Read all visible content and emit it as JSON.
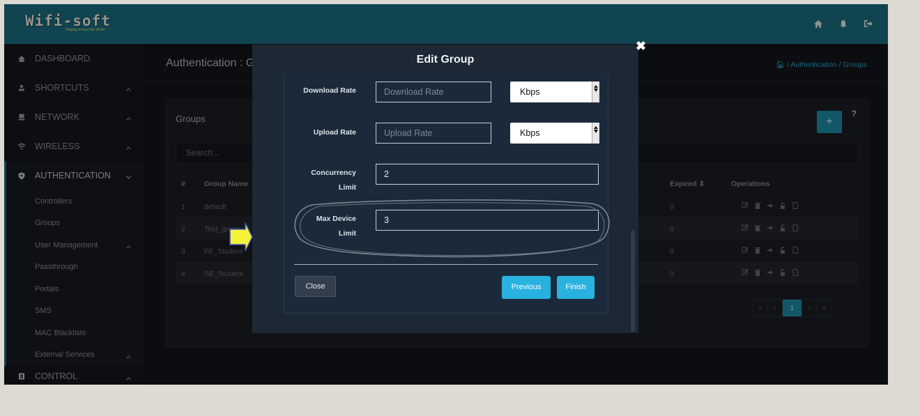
{
  "app": {
    "logo_text": "Wifi-soft",
    "logo_tagline": "Helping ensure the World"
  },
  "sidebar": {
    "sections_top": [
      {
        "label": "DASHBOARD",
        "icon": "dashboard-icon"
      },
      {
        "label": "SHORTCUTS",
        "icon": "user-icon",
        "chevron": "^"
      },
      {
        "label": "NETWORK",
        "icon": "monitor-icon",
        "chevron": "^"
      },
      {
        "label": "WIRELESS",
        "icon": "wifi-icon",
        "chevron": "^"
      },
      {
        "label": "AUTHENTICATION",
        "icon": "shield-icon",
        "chevron": "v"
      }
    ],
    "auth_items": [
      {
        "label": "Controllers"
      },
      {
        "label": "Groups"
      },
      {
        "label": "User Management",
        "chevron": "^"
      },
      {
        "label": "Passthrough"
      },
      {
        "label": "Portals"
      },
      {
        "label": "SMS"
      },
      {
        "label": "MAC Blacklists"
      },
      {
        "label": "External Services",
        "chevron": "^"
      }
    ],
    "section_bottom": {
      "label": "CONTROL",
      "icon": "control-icon",
      "chevron": "^"
    }
  },
  "page": {
    "title": "Authentication : G",
    "breadcrumb": "/ Authentication / Groups"
  },
  "groups_panel": {
    "title": "Groups",
    "add_label": "+",
    "help_label": "?",
    "search_placeholder": "Search...",
    "columns": {
      "num": "#",
      "name": "Group Name",
      "expired": "Expired ⇕",
      "operations": "Operations"
    },
    "rows": [
      {
        "num": "1",
        "name": "default",
        "expired": "0"
      },
      {
        "num": "2",
        "name": "Test_group",
        "expired": "0"
      },
      {
        "num": "3",
        "name": "FE_Student",
        "expired": "0"
      },
      {
        "num": "4",
        "name": "SE_Student",
        "expired": "0"
      }
    ],
    "pagination": [
      "«",
      "‹",
      "1",
      "›",
      "»"
    ]
  },
  "modal": {
    "title": "Edit Group",
    "close_symbol": "✖",
    "download_rate": {
      "label": "Download Rate",
      "placeholder": "Download Rate",
      "unit": "Kbps"
    },
    "upload_rate": {
      "label": "Upload Rate",
      "placeholder": "Upload Rate",
      "unit": "Kbps"
    },
    "concurrency_limit": {
      "label_line1": "Concurrency",
      "label_line2": "Limit",
      "value": "2"
    },
    "max_device_limit": {
      "label_line1": "Max Device",
      "label_line2": "Limit",
      "value": "3"
    },
    "close_button": "Close",
    "previous_button": "Previous",
    "finish_button": "Finish"
  },
  "colors": {
    "topbar": "#1c6f84",
    "accent": "#1d8ea9",
    "modal_bg": "#1d2835",
    "primary_button": "#29b2e0",
    "pointer_fill": "#f6f23a"
  }
}
